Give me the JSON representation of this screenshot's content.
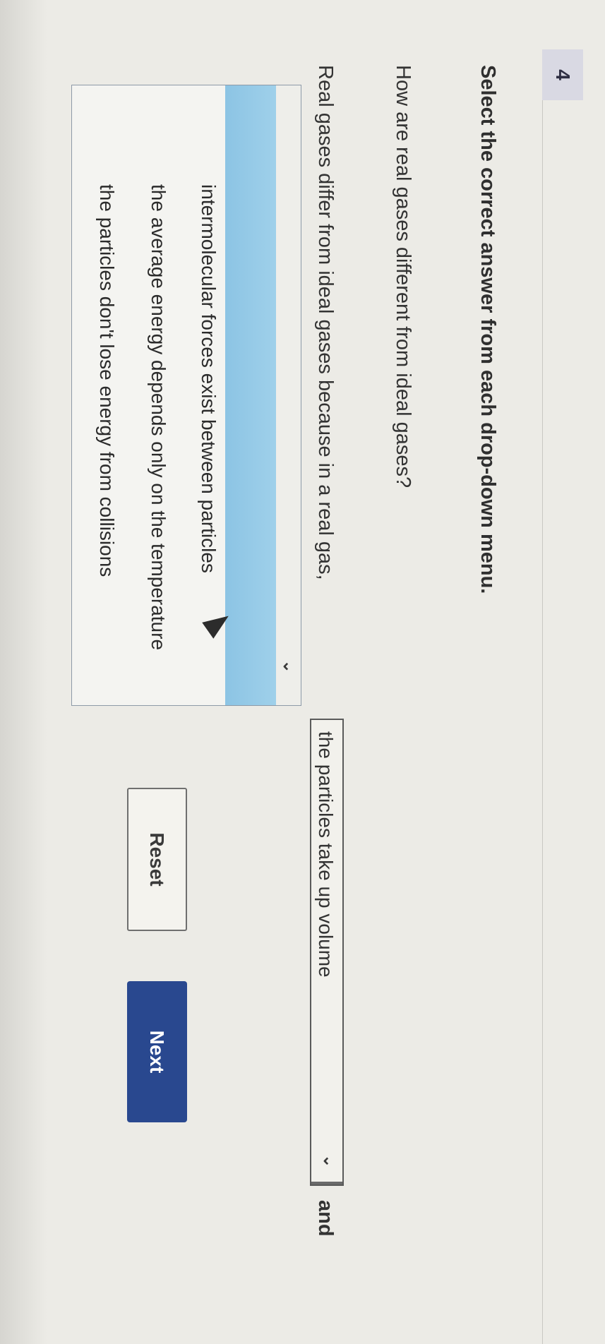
{
  "question_number": "4",
  "instruction": "Select the correct answer from each drop-down menu.",
  "question": "How are real gases different from ideal gases?",
  "sentence": {
    "start": "Real gases differ from ideal gases because in a real gas,",
    "middle": "and"
  },
  "dropdown_1": {
    "selected": "the particles take up volume",
    "chevron_icon": "chevron-down-icon"
  },
  "dropdown_2": {
    "selected": "",
    "chevron_icon": "chevron-down-icon",
    "options": [
      "intermolecular forces exist between particles",
      "the average energy depends only on the temperature",
      "the particles don't lose energy from collisions"
    ],
    "highlight_color": "#9fd0ea"
  },
  "buttons": {
    "reset": "Reset",
    "next": "Next"
  },
  "colors": {
    "next_button": "#29488f",
    "badge": "#d9d9e3"
  }
}
